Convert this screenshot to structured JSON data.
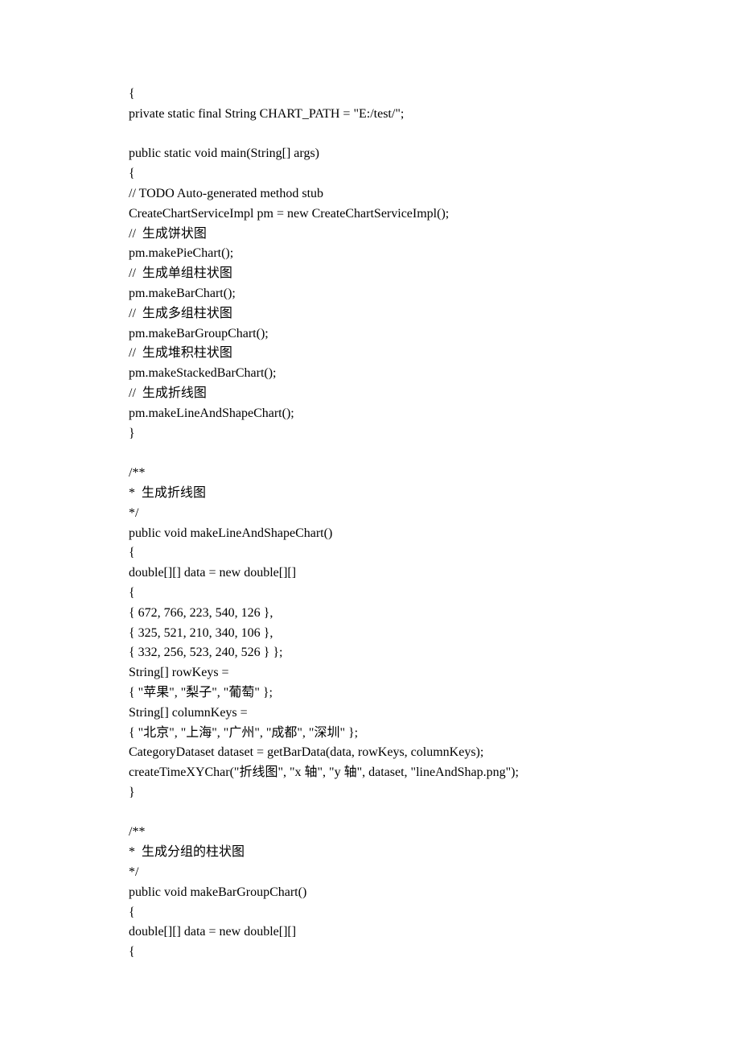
{
  "lines": [
    "{",
    "private static final String CHART_PATH = \"E:/test/\";",
    "",
    "public static void main(String[] args)",
    "{",
    "// TODO Auto-generated method stub",
    "CreateChartServiceImpl pm = new CreateChartServiceImpl();",
    "//  生成饼状图",
    "pm.makePieChart();",
    "//  生成单组柱状图",
    "pm.makeBarChart();",
    "//  生成多组柱状图",
    "pm.makeBarGroupChart();",
    "//  生成堆积柱状图",
    "pm.makeStackedBarChart();",
    "//  生成折线图",
    "pm.makeLineAndShapeChart();",
    "}",
    "",
    "/**",
    "*  生成折线图",
    "*/",
    "public void makeLineAndShapeChart()",
    "{",
    "double[][] data = new double[][]",
    "{",
    "{ 672, 766, 223, 540, 126 },",
    "{ 325, 521, 210, 340, 106 },",
    "{ 332, 256, 523, 240, 526 } };",
    "String[] rowKeys =",
    "{ \"苹果\", \"梨子\", \"葡萄\" };",
    "String[] columnKeys =",
    "{ \"北京\", \"上海\", \"广州\", \"成都\", \"深圳\" };",
    "CategoryDataset dataset = getBarData(data, rowKeys, columnKeys);",
    "createTimeXYChar(\"折线图\", \"x 轴\", \"y 轴\", dataset, \"lineAndShap.png\");",
    "}",
    "",
    "/**",
    "*  生成分组的柱状图",
    "*/",
    "public void makeBarGroupChart()",
    "{",
    "double[][] data = new double[][]",
    "{"
  ]
}
